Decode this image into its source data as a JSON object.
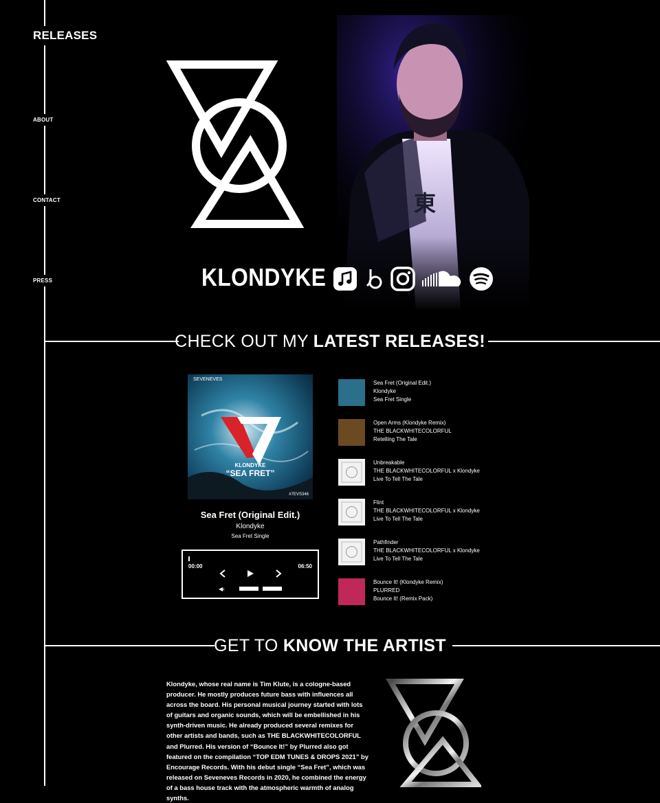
{
  "nav": {
    "items": [
      {
        "label": "RELEASES"
      },
      {
        "label": "ABOUT"
      },
      {
        "label": "CONTACT"
      },
      {
        "label": "PRESS"
      }
    ]
  },
  "hero": {
    "artist_name": "KLONDYKE",
    "socials": [
      {
        "icon": "apple-music-icon"
      },
      {
        "icon": "beatport-icon"
      },
      {
        "icon": "instagram-icon"
      },
      {
        "icon": "soundcloud-icon"
      },
      {
        "icon": "spotify-icon"
      }
    ]
  },
  "releases_section": {
    "title_thin": "CHECK OUT MY",
    "title_bold": "LATEST RELEASES!"
  },
  "now_playing": {
    "cover": {
      "label": "SEVENEVES",
      "artist": "KLONDYKE",
      "title": "“SEA FRET”",
      "catalog": "#7EVS346"
    },
    "title": "Sea Fret (Original Edit.)",
    "artist": "Klondyke",
    "release": "Sea Fret Single",
    "time_current": "00:00",
    "time_total": "06:50",
    "progress": 0,
    "volume_symbol": "◀‹"
  },
  "tracks": [
    {
      "title": "Sea Fret (Original Edit.)",
      "artist": "Klondyke",
      "release": "Sea Fret Single",
      "thumb_color": "#2b6f8a"
    },
    {
      "title": "Open Arms (Klondyke Remix)",
      "artist": "THE BLACKWHITECOLORFUL",
      "release": "Retelling The Tale",
      "thumb_color": "#6b4a22"
    },
    {
      "title": "Unbreakable",
      "artist": "THE BLACKWHITECOLORFUL x Klondyke",
      "release": "Live To Tell The Tale",
      "thumb_color": "#f2f2f2"
    },
    {
      "title": "Flint",
      "artist": "THE BLACKWHITECOLORFUL x Klondyke",
      "release": "Live To Tell The Tale",
      "thumb_color": "#f2f2f2"
    },
    {
      "title": "Pathfinder",
      "artist": "THE BLACKWHITECOLORFUL x Klondyke",
      "release": "Live To Tell The Tale",
      "thumb_color": "#f2f2f2"
    },
    {
      "title": "Bounce It! (Klondyke Remix)",
      "artist": "PLURRED",
      "release": "Bounce It! (Remix Pack)",
      "thumb_color": "#c0285a"
    }
  ],
  "about_section": {
    "title_thin": "GET TO",
    "title_bold": "KNOW THE ARTIST",
    "bio": "Klondyke, whose real name is Tim Klute, is a cologne-based producer. He mostly produces future bass with influences all across the board. His personal musical journey started with lots of guitars and organic sounds, which will be embellished in his synth-driven music. He already produced several remixes for other artists and bands, such as THE BLACKWHITECOLORFUL and Plurred. His version of “Bounce It!” by Plurred also got featured on the compilation “TOP EDM TUNES & DROPS 2021” by Encourage Records. With his debut single “Sea Fret”, which was released on Seveneves Records in 2020, he combined the energy of a bass house track with the atmospheric warmth of analog synths."
  },
  "colors": {
    "background": "#000000",
    "foreground": "#ffffff",
    "accent_red": "#d8232a",
    "photo_glow": "#6b2cff"
  }
}
